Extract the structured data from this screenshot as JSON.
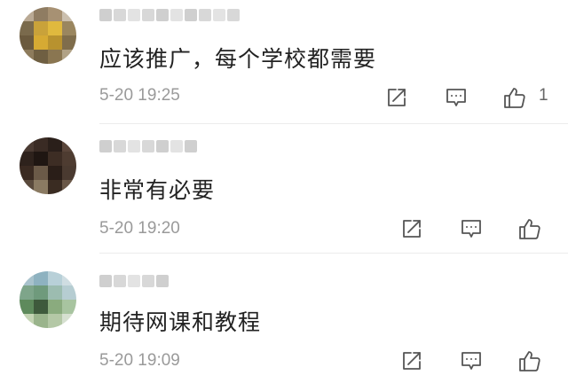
{
  "colors": {
    "text": "#222222",
    "meta": "#9a9a9a",
    "icon": "#555555",
    "divider": "#ececec"
  },
  "comments": [
    {
      "text": "应该推广，每个学校都需要",
      "time": "5-20 19:25",
      "like_count": "1",
      "icons": [
        "share-icon",
        "reply-icon",
        "thumbs-up-icon"
      ]
    },
    {
      "text": "非常有必要",
      "time": "5-20 19:20",
      "like_count": "",
      "icons": [
        "share-icon",
        "reply-icon",
        "thumbs-up-icon"
      ]
    },
    {
      "text": "期待网课和教程",
      "time": "5-20 19:09",
      "like_count": "",
      "icons": [
        "share-icon",
        "reply-icon",
        "thumbs-up-icon"
      ]
    }
  ]
}
